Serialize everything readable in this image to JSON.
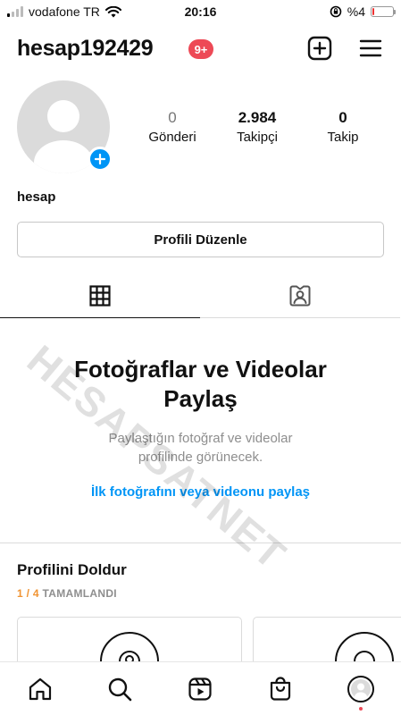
{
  "status_bar": {
    "carrier": "vodafone TR",
    "time": "20:16",
    "battery_text": "%4",
    "battery_level": 0.04,
    "signal_bars": 1
  },
  "header": {
    "username": "hesap192429",
    "notification_badge": "9+",
    "icons": [
      "new-post-icon",
      "menu-icon"
    ]
  },
  "profile": {
    "display_name": "hesap",
    "stats": [
      {
        "value": "0",
        "label": "Gönderi"
      },
      {
        "value": "2.984",
        "label": "Takipçi"
      },
      {
        "value": "0",
        "label": "Takip"
      }
    ],
    "edit_button": "Profili Düzenle"
  },
  "tabs": [
    {
      "icon": "grid-icon",
      "active": true
    },
    {
      "icon": "tagged-icon",
      "active": false
    }
  ],
  "empty_state": {
    "title": "Fotoğraflar ve Videolar Paylaş",
    "subtitle": "Paylaştığın fotoğraf ve videolar profilinde görünecek.",
    "link": "İlk fotoğrafını veya videonu paylaş"
  },
  "complete_profile": {
    "title": "Profilini Doldur",
    "progress_done": "1 / 4",
    "progress_label": "TAMAMLANDI"
  },
  "watermark": "HESAPSATNET",
  "bottom_nav": [
    "home-icon",
    "search-icon",
    "reels-icon",
    "shop-icon",
    "profile-avatar"
  ],
  "colors": {
    "accent": "#0095f6",
    "badge": "#ed4956",
    "progress": "#f09433",
    "muted": "#8e8e8e"
  }
}
